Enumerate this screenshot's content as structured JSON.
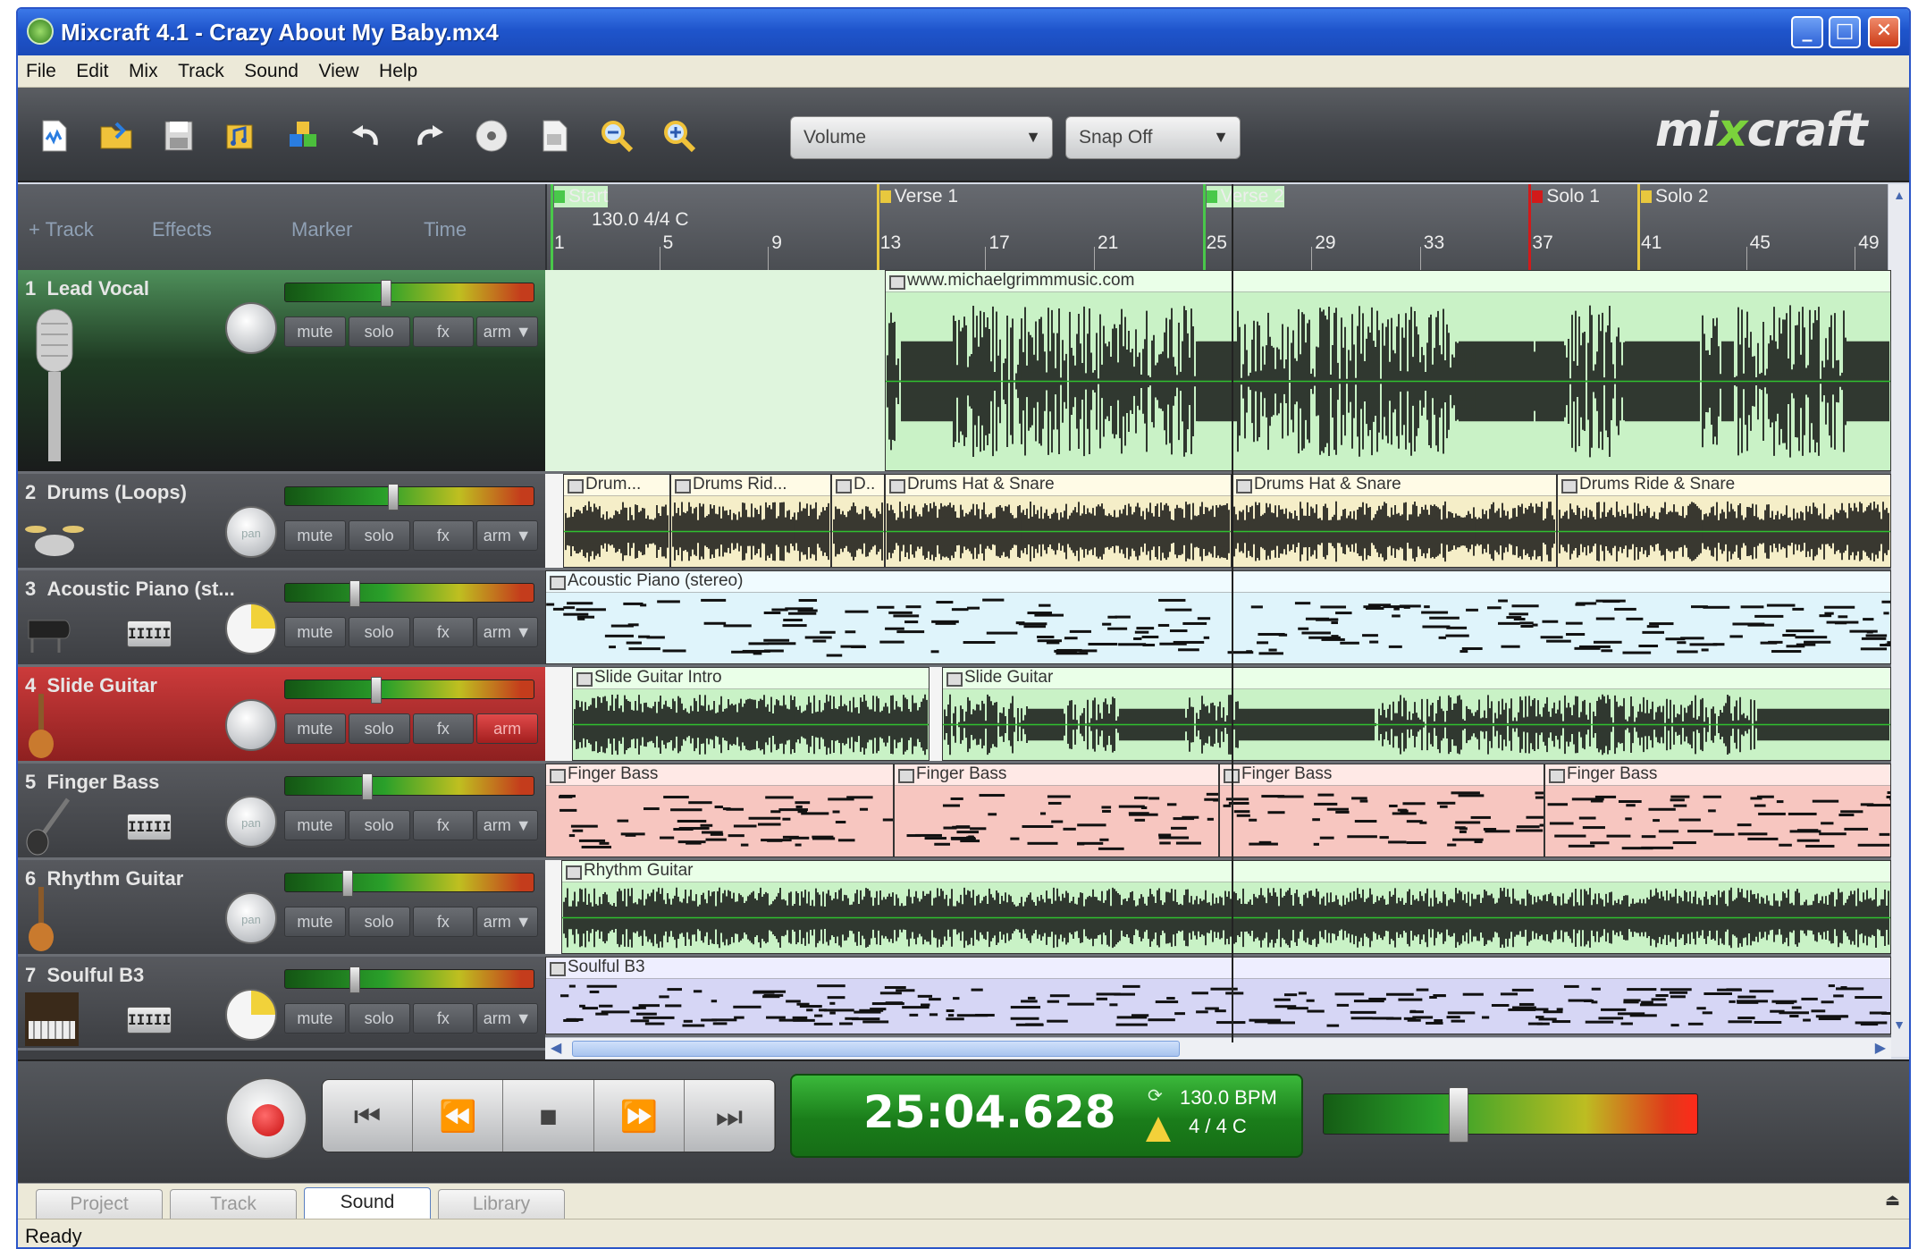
{
  "window": {
    "title": "Mixcraft 4.1 - Crazy About My Baby.mx4",
    "controls": {
      "minimize": "_",
      "maximize": "□",
      "close": "✕"
    }
  },
  "menu": [
    "File",
    "Edit",
    "Mix",
    "Track",
    "Sound",
    "View",
    "Help"
  ],
  "toolbar": {
    "icons": [
      "new-project-icon",
      "open-folder-icon",
      "save-icon",
      "add-loop-icon",
      "add-instrument-icon",
      "undo-icon",
      "redo-icon",
      "cd-icon",
      "mixdown-icon",
      "zoom-out-icon",
      "zoom-in-icon"
    ],
    "volume_dropdown": "Volume",
    "snap_dropdown": "Snap Off",
    "dropdown_arrow": "▼",
    "logo": {
      "left": "mi",
      "x": "x",
      "right": "craft"
    }
  },
  "track_head": {
    "track": "+ Track",
    "effects": "Effects",
    "marker": "Marker",
    "time": "Time"
  },
  "ruler": {
    "markers": [
      {
        "label": "Start",
        "bar": 1,
        "color": "#49c84a"
      },
      {
        "label": "Verse 1",
        "bar": 13,
        "color": "#e8c83e"
      },
      {
        "label": "Verse 2",
        "bar": 25,
        "color": "#49c84a"
      },
      {
        "label": "Solo 1",
        "bar": 37,
        "color": "#d21a1a"
      },
      {
        "label": "Solo 2",
        "bar": 41,
        "color": "#e8c83e"
      }
    ],
    "tempo_label": "130.0 4/4 C",
    "bars": [
      "1",
      "5",
      "9",
      "13",
      "17",
      "21",
      "25",
      "29",
      "33",
      "37",
      "41",
      "45",
      "49"
    ]
  },
  "tracks": [
    {
      "num": "1",
      "name": "Lead Vocal",
      "vol": 0.4,
      "buttons": [
        "mute",
        "solo",
        "fx",
        "arm ▼"
      ]
    },
    {
      "num": "2",
      "name": "Drums (Loops)",
      "vol": 0.43,
      "pan_label": "pan",
      "buttons": [
        "mute",
        "solo",
        "fx",
        "arm ▼"
      ]
    },
    {
      "num": "3",
      "name": "Acoustic Piano (st...",
      "vol": 0.27,
      "piano": "IIIII",
      "buttons": [
        "mute",
        "solo",
        "fx",
        "arm ▼"
      ]
    },
    {
      "num": "4",
      "name": "Slide Guitar",
      "vol": 0.36,
      "buttons": [
        "mute",
        "solo",
        "fx",
        "arm"
      ]
    },
    {
      "num": "5",
      "name": "Finger Bass",
      "vol": 0.32,
      "pan_label": "pan",
      "piano": "IIIII",
      "buttons": [
        "mute",
        "solo",
        "fx",
        "arm ▼"
      ]
    },
    {
      "num": "6",
      "name": "Rhythm Guitar",
      "vol": 0.24,
      "pan_label": "pan",
      "buttons": [
        "mute",
        "solo",
        "fx",
        "arm ▼"
      ]
    },
    {
      "num": "7",
      "name": "Soulful B3",
      "vol": 0.27,
      "piano": "IIIII",
      "buttons": [
        "mute",
        "solo",
        "fx",
        "arm ▼"
      ]
    }
  ],
  "lanes": {
    "lead": [
      {
        "title": "www.michaelgrimmmusic.com"
      }
    ],
    "drums": [
      {
        "title": "Drum..."
      },
      {
        "title": "Drums Rid..."
      },
      {
        "title": "D.."
      },
      {
        "title": "Drums Hat & Snare"
      },
      {
        "title": "Drums Hat & Snare"
      },
      {
        "title": "Drums Ride & Snare"
      }
    ],
    "piano": [
      {
        "title": "Acoustic Piano (stereo)"
      }
    ],
    "slide": [
      {
        "title": "Slide Guitar Intro"
      },
      {
        "title": "Slide Guitar"
      }
    ],
    "bass": [
      {
        "title": "Finger Bass"
      },
      {
        "title": "Finger Bass"
      },
      {
        "title": "Finger Bass"
      },
      {
        "title": "Finger Bass"
      }
    ],
    "rhythm": [
      {
        "title": "Rhythm Guitar"
      }
    ],
    "b3": [
      {
        "title": "Soulful B3"
      }
    ]
  },
  "transport": {
    "buttons": [
      "⏮",
      "⏪",
      "■",
      "⏩",
      "⏭"
    ],
    "time": "25:04.628",
    "bpm": "130.0 BPM",
    "signature": "4 / 4   C",
    "master_level": 0.35
  },
  "tabs": [
    "Project",
    "Track",
    "Sound",
    "Library"
  ],
  "active_tab": "Sound",
  "status": "Ready"
}
